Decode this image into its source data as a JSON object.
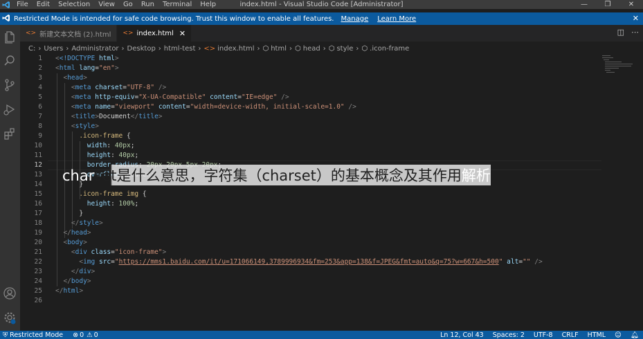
{
  "titlebar": {
    "menu": [
      "File",
      "Edit",
      "Selection",
      "View",
      "Go",
      "Run",
      "Terminal",
      "Help"
    ],
    "title": "index.html - Visual Studio Code [Administrator]"
  },
  "banner": {
    "message": "Restricted Mode is intended for safe code browsing. Trust this window to enable all features.",
    "manage": "Manage",
    "learn_more": "Learn More"
  },
  "tabs": [
    {
      "label": "新建文本文档 (2).html",
      "active": false
    },
    {
      "label": "index.html",
      "active": true
    }
  ],
  "breadcrumb": [
    "C:",
    "Users",
    "Administrator",
    "Desktop",
    "html-test",
    "index.html",
    "html",
    "head",
    "style",
    ".icon-frame"
  ],
  "editor": {
    "current_line": 12,
    "lines": [
      "1",
      "2",
      "3",
      "4",
      "5",
      "6",
      "7",
      "8",
      "9",
      "10",
      "11",
      "12",
      "13",
      "14",
      "15",
      "16",
      "17",
      "18",
      "19",
      "20",
      "21",
      "22",
      "23",
      "24",
      "25",
      "26"
    ],
    "code": {
      "l1_a": "<!DOCTYPE",
      "l1_b": " html",
      "l1_c": ">",
      "l2_tag": "html",
      "l2_attr": "lang",
      "l2_val": "\"en\"",
      "l3_tag": "head",
      "l4_tag": "meta",
      "l4_attr": "charset",
      "l4_val": "\"UTF-8\"",
      "l5_tag": "meta",
      "l5_attr1": "http-equiv",
      "l5_val1": "\"X-UA-Compatible\"",
      "l5_attr2": "content",
      "l5_val2": "\"IE=edge\"",
      "l6_tag": "meta",
      "l6_attr1": "name",
      "l6_val1": "\"viewport\"",
      "l6_attr2": "content",
      "l6_val2": "\"width=device-width, initial-scale=1.0\"",
      "l7_tag": "title",
      "l7_text": "Document",
      "l8_tag": "style",
      "l9_sel": ".icon-frame",
      "l9_brace": " {",
      "l10_prop": "width",
      "l10_val": "40px",
      "l11_prop": "height",
      "l11_val": "40px",
      "l12_prop": "border-radius",
      "l12_val": "20px 20px 5px 20px",
      "l13_prop": "overflow",
      "l13_val": "hidden",
      "l14_brace": "}",
      "l15_sel": ".icon-frame img",
      "l15_brace": " {",
      "l16_prop": "height",
      "l16_val": "100%",
      "l17_brace": "}",
      "l18_tag": "style",
      "l19_tag": "head",
      "l20_tag": "body",
      "l21_tag": "div",
      "l21_attr": "class",
      "l21_val": "\"icon-frame\"",
      "l22_tag": "img",
      "l22_attr1": "src",
      "l22_url": "https://mms1.baidu.com/it/u=171066149,3789996934&fm=253&app=138&f=JPEG&fmt=auto&q=75?w=667&h=500",
      "l22_attr2": "alt",
      "l22_val2": "\"\"",
      "l23_tag": "div",
      "l24_tag": "body",
      "l25_tag": "html"
    }
  },
  "overlay_title": {
    "lead": "char",
    "rest": "set是什么意思，字符集（charset）的基本概念及其作用",
    "tail": "解析"
  },
  "statusbar": {
    "mode": "Restricted Mode",
    "errors": "0",
    "warnings": "0",
    "position": "Ln 12, Col 43",
    "spaces": "Spaces: 2",
    "encoding": "UTF-8",
    "eol": "CRLF",
    "language": "HTML"
  },
  "colors": {
    "accent": "#007acc",
    "tag": "#569cd6",
    "attr": "#9cdcfe",
    "string": "#ce9178",
    "selector": "#d7ba7d",
    "number": "#b5cea8"
  }
}
